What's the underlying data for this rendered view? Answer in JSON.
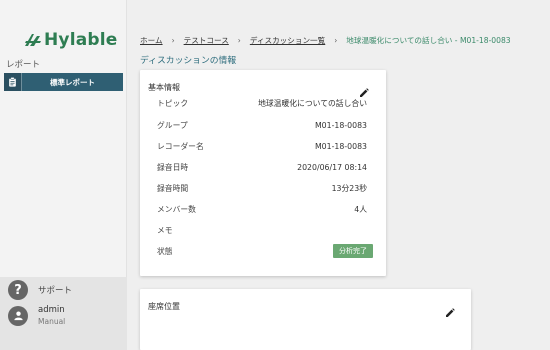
{
  "sidebar": {
    "brand": "Hylable",
    "section_label": "レポート",
    "nav_item_label": "標準レポート",
    "support_label": "サポート",
    "user_name": "admin",
    "user_role": "Manual"
  },
  "breadcrumb": {
    "home": "ホーム",
    "course": "テストコース",
    "discussion_list": "ディスカッション一覧",
    "current": "地球温暖化についての話し合い - M01-18-0083",
    "separator": "›"
  },
  "page_title": "ディスカッションの情報",
  "basic_info": {
    "heading": "基本情報",
    "rows": [
      {
        "label": "トピック",
        "value": "地球温暖化についての話し合い"
      },
      {
        "label": "グループ",
        "value": "M01-18-0083"
      },
      {
        "label": "レコーダー名",
        "value": "M01-18-0083"
      },
      {
        "label": "録音日時",
        "value": "2020/06/17 08:14"
      },
      {
        "label": "録音時間",
        "value": "13分23秒"
      },
      {
        "label": "メンバー数",
        "value": "4人"
      },
      {
        "label": "メモ",
        "value": ""
      },
      {
        "label": "状態",
        "value": "分析完了"
      }
    ]
  },
  "seat_info": {
    "heading": "座席位置"
  },
  "colors": {
    "brand": "#2e7d52",
    "nav_active": "#2f5f73",
    "status_done": "#6aa872",
    "title": "#2f6e7e"
  },
  "icons": {
    "brand_logo": "hylable-leaf-logo",
    "nav": "clipboard-icon",
    "support": "help-icon",
    "user": "person-icon",
    "edit": "pencil-icon"
  }
}
